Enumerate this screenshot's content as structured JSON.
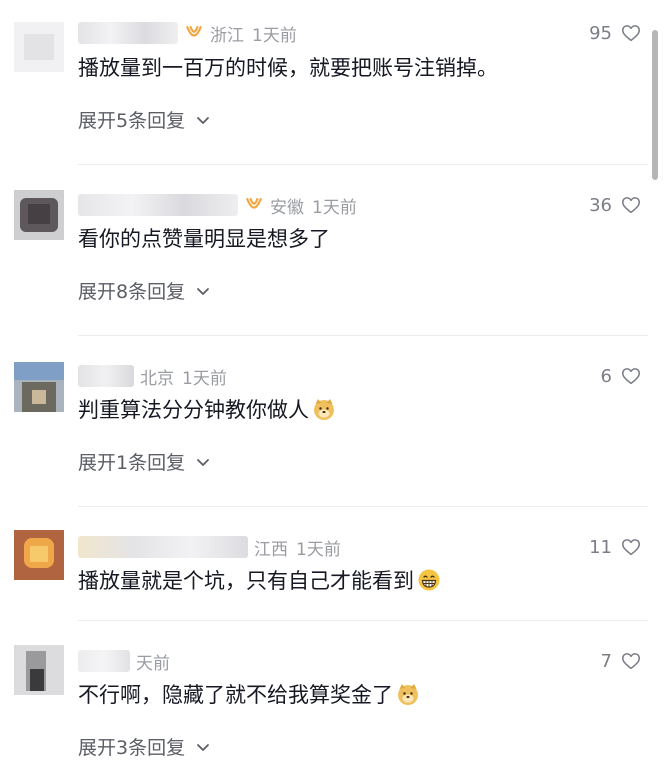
{
  "comments": [
    {
      "location": "浙江",
      "time": "1天前",
      "likes": "95",
      "text": "播放量到一百万的时候，就要把账号注销掉。",
      "replies_label": "展开5条回复",
      "has_badge": true,
      "emoji": ""
    },
    {
      "location": "安徽",
      "time": "1天前",
      "likes": "36",
      "text": "看你的点赞量明显是想多了",
      "replies_label": "展开8条回复",
      "has_badge": true,
      "emoji": ""
    },
    {
      "location": "北京",
      "time": "1天前",
      "likes": "6",
      "text": "判重算法分分钟教你做人",
      "replies_label": "展开1条回复",
      "has_badge": false,
      "emoji": "doge-emoji"
    },
    {
      "location": "江西",
      "time": "1天前",
      "likes": "11",
      "text": "播放量就是个坑，只有自己才能看到",
      "replies_label": "",
      "has_badge": false,
      "emoji": "grin-emoji"
    },
    {
      "location": "",
      "time": "天前",
      "likes": "7",
      "text": "不行啊，隐藏了就不给我算奖金了",
      "replies_label": "展开3条回复",
      "has_badge": false,
      "emoji": "doge-emoji"
    }
  ],
  "colors": {
    "meta_gray": "#9a9ca3",
    "badge_orange": "#f4a640",
    "text": "#161823"
  },
  "icons": {
    "like": "heart-outline-icon",
    "expand": "chevron-down-icon",
    "badge": "fan-badge-icon"
  }
}
